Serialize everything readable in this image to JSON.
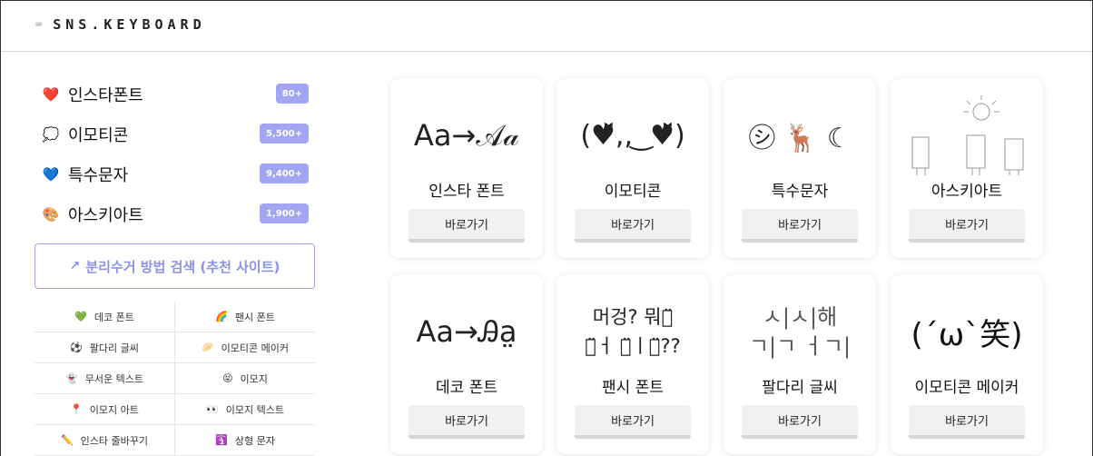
{
  "header": {
    "logo_icon": "keyboard-icon",
    "logo_text": "SNS.KEYBOARD"
  },
  "sidebar": {
    "categories": [
      {
        "icon": "❤️",
        "label": "인스타폰트",
        "badge": "80+"
      },
      {
        "icon": "💭",
        "label": "이모티콘",
        "badge": "5,500+"
      },
      {
        "icon": "💙",
        "label": "특수문자",
        "badge": "9,400+"
      },
      {
        "icon": "🎨",
        "label": "아스키아트",
        "badge": "1,900+"
      }
    ],
    "search_button": {
      "icon": "external-link-icon",
      "label": "분리수거 방법 검색 (추천 사이트)"
    },
    "links": [
      {
        "icon": "💚",
        "label": "데코 폰트"
      },
      {
        "icon": "🌈",
        "label": "팬시 폰트"
      },
      {
        "icon": "⚽",
        "label": "팔다리 글씨"
      },
      {
        "icon": "🥟",
        "label": "이모티콘 메이커"
      },
      {
        "icon": "👻",
        "label": "무서운 텍스트"
      },
      {
        "icon": "😝",
        "label": "이모지"
      },
      {
        "icon": "📍",
        "label": "이모지 아트"
      },
      {
        "icon": "👀",
        "label": "이모지 텍스트"
      },
      {
        "icon": "✏️",
        "label": "인스타 줄바꾸기"
      },
      {
        "icon": "🛐",
        "label": "상형 문자"
      }
    ]
  },
  "cards": [
    {
      "title": "인스타 폰트",
      "button": "바로가기",
      "art": [
        "Aa→𝒜𝒶"
      ]
    },
    {
      "title": "이모티콘",
      "button": "바로가기",
      "art": [
        "(♥̆̈,, ͜ ♥̆̈)"
      ]
    },
    {
      "title": "특수문자",
      "button": "바로가기",
      "art": [
        "㋛ 🦌 ☾"
      ]
    },
    {
      "title": "아스키아트",
      "button": "바로가기",
      "art": [
        "ascii-cats-sun"
      ]
    },
    {
      "title": "데코 폰트",
      "button": "바로가기",
      "art": [
        "Aa→Ꭿa̤"
      ]
    },
    {
      "title": "팬시 폰트",
      "button": "바로가기",
      "art": [
        "머겅? 뭐해̈",
        "자̈ㅓ 밖̈ㅣ야̈??"
      ]
    },
    {
      "title": "팔다리 글씨",
      "button": "바로가기",
      "art": [
        "ㅅ|ㅅ|해",
        "ㄱ|ㄱ ㅓㄱ|"
      ]
    },
    {
      "title": "이모티콘 메이커",
      "button": "바로가기",
      "art": [
        "(´ω`笑)"
      ]
    }
  ],
  "colors": {
    "accent": "#9ea3ea",
    "badge": "#a2a6f2",
    "button_bg": "#f1f1f1"
  }
}
